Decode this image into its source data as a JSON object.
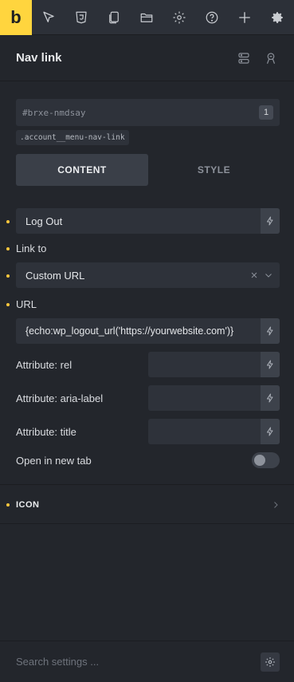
{
  "toolbar": {
    "logo": "b",
    "icons": [
      "cursor-icon",
      "css3-icon",
      "pages-icon",
      "folder-icon",
      "gear-icon",
      "help-icon",
      "plus-icon",
      "settings-cog-icon"
    ]
  },
  "panel": {
    "title": "Nav link"
  },
  "element": {
    "id": "#brxe-nmdsay",
    "id_count": "1",
    "class_name": ".account__menu-nav-link"
  },
  "tabs": {
    "content": "CONTENT",
    "style": "STYLE"
  },
  "fields": {
    "text_value": "Log Out",
    "link_to_label": "Link to",
    "link_to_value": "Custom URL",
    "url_label": "URL",
    "url_value": "{echo:wp_logout_url('https://yourwebsite.com')}",
    "attr_rel_label": "Attribute: rel",
    "attr_rel_value": "",
    "attr_aria_label": "Attribute: aria-label",
    "attr_aria_value": "",
    "attr_title_label": "Attribute: title",
    "attr_title_value": "",
    "new_tab_label": "Open in new tab",
    "new_tab_checked": false
  },
  "sections": {
    "icon_title": "ICON"
  },
  "footer": {
    "search_placeholder": "Search settings ..."
  },
  "colors": {
    "accent": "#ffd53e",
    "dot": "#ffc83d",
    "background": "#23262c",
    "field": "#2e323a"
  }
}
